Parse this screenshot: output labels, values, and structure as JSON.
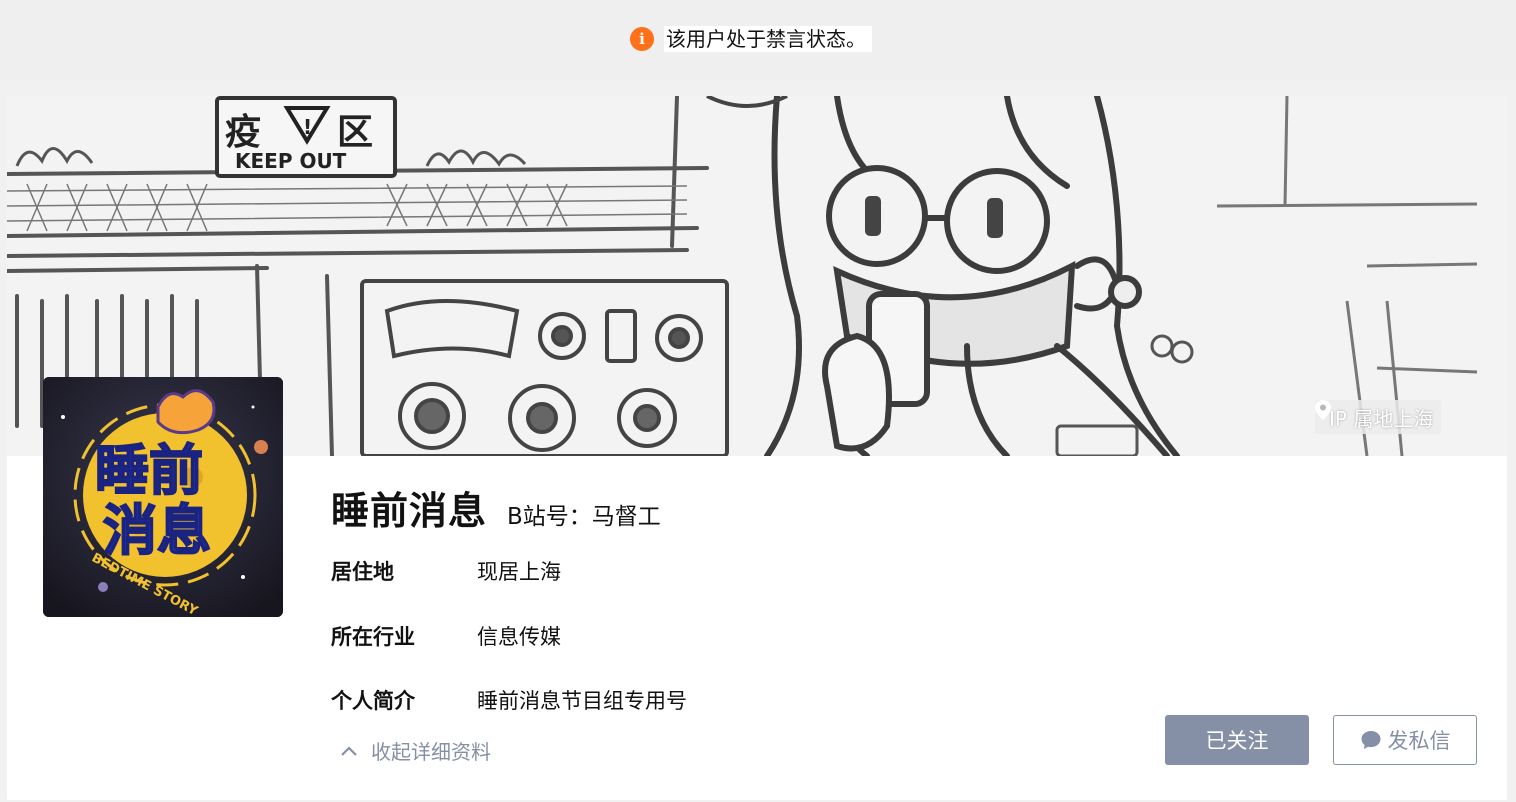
{
  "notice": {
    "icon": "info-icon",
    "text": "该用户处于禁言状态。",
    "icon_color": "#ff7119"
  },
  "banner": {
    "image": "sketch-illustration-nurse-with-mask",
    "sign_text_1": "疫",
    "sign_text_2": "区",
    "sign_text_3": "KEEP OUT",
    "ip_icon": "location-pin-icon",
    "ip_location": "IP 属地上海"
  },
  "avatar": {
    "line1": "睡前",
    "line2": "消息",
    "ring_text": "BEDTIME STORY"
  },
  "profile": {
    "name": "睡前消息",
    "bili_id": "B站号：马督工",
    "fields": [
      {
        "label": "居住地",
        "value": "现居上海"
      },
      {
        "label": "所在行业",
        "value": "信息传媒"
      },
      {
        "label": "个人简介",
        "value": "睡前消息节目组专用号"
      }
    ],
    "collapse_label": "收起详细资料"
  },
  "actions": {
    "followed_label": "已关注",
    "message_label": "发私信"
  },
  "colors": {
    "accent_gray": "#8590a6",
    "page_bg": "#f1f1f1"
  }
}
